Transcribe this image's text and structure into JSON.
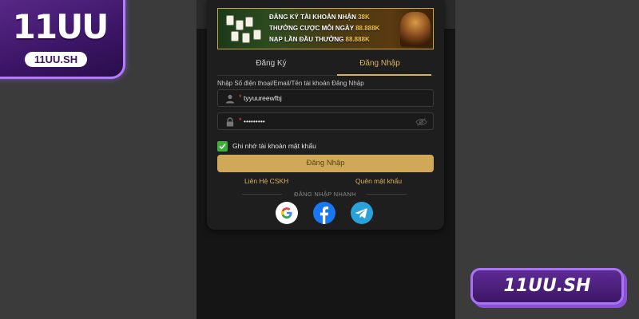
{
  "brand": {
    "logo_text": "11UU",
    "logo_domain": "11UU.SH",
    "badge_text": "11UU.SH",
    "accent": "#d9b25f",
    "purple": "#5a2a8a"
  },
  "banner": {
    "line1_prefix": "ĐĂNG KÝ TÀI KHOẢN NHẬN ",
    "line1_highlight": "38K",
    "line2_prefix": "THƯỞNG CƯỢC MỖI NGÀY ",
    "line2_highlight": "88.888K",
    "line3_prefix": "NẠP LẦN  ĐẦU THƯỞNG ",
    "line3_highlight": "88.888K"
  },
  "tabs": [
    {
      "label": "Đăng Ký",
      "active": false
    },
    {
      "label": "Đăng Nhập",
      "active": true
    }
  ],
  "form": {
    "hint": "Nhập Số điện thoại/Email/Tên tài khoản Đăng Nhập",
    "required_mark": "*",
    "username_value": "tyyuureewfbj",
    "password_value": "•••••••••",
    "remember_label": "Ghi nhớ tài khoản mật khẩu",
    "remember_checked": true,
    "submit_label": "Đăng Nhập"
  },
  "links": {
    "support": "Liên Hệ CSKH",
    "forgot": "Quên mật khẩu"
  },
  "quick_login": {
    "label": "ĐĂNG NHẬP NHANH",
    "providers": [
      "google-icon",
      "facebook-icon",
      "telegram-icon"
    ]
  }
}
